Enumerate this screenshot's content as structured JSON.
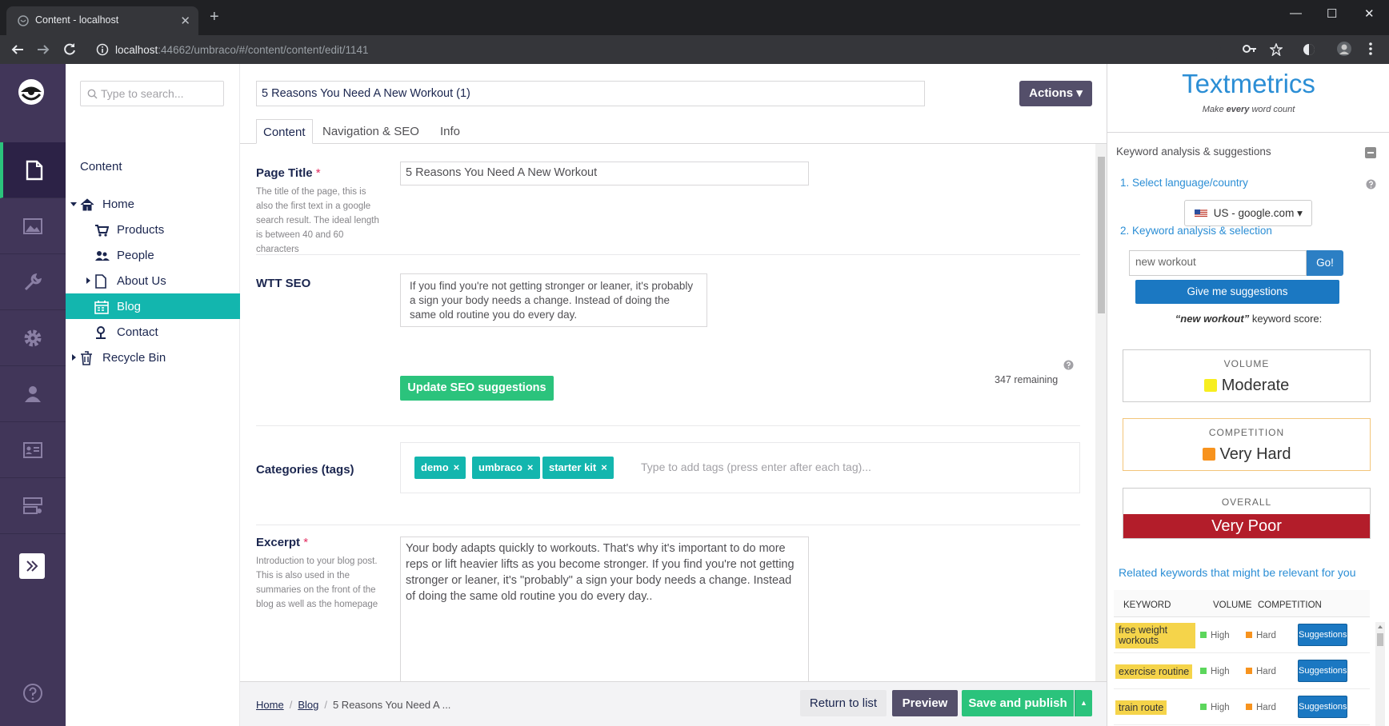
{
  "browser": {
    "tab_title": "Content - localhost",
    "url_host": "localhost",
    "url_rest": ":44662/umbraco/#/content/content/edit/1141"
  },
  "sidebar_nav": {
    "items": [
      "content-icon",
      "media-icon",
      "settings-icon",
      "gear-icon",
      "user-icon",
      "members-icon",
      "forms-icon"
    ],
    "accent": "#2bc37c",
    "bg": "#413659"
  },
  "tree": {
    "search_placeholder": "Type to search...",
    "heading": "Content",
    "nodes": [
      {
        "label": "Home",
        "icon": "home-icon"
      },
      {
        "label": "Products",
        "icon": "cart-icon"
      },
      {
        "label": "People",
        "icon": "people-icon"
      },
      {
        "label": "About Us",
        "icon": "document-icon"
      },
      {
        "label": "Blog",
        "icon": "calendar-icon"
      },
      {
        "label": "Contact",
        "icon": "map-pin-icon"
      },
      {
        "label": "Recycle Bin",
        "icon": "trash-icon"
      }
    ]
  },
  "editor": {
    "node_name": "5 Reasons You Need A New Workout (1)",
    "actions_label": "Actions",
    "tabs": [
      "Content",
      "Navigation & SEO",
      "Info"
    ],
    "page_title": {
      "label": "Page Title",
      "required": "*",
      "description": "The title of the page, this is also the first text in a google search result. The ideal length is between 40 and 60 characters",
      "value": "5 Reasons You Need A New Workout"
    },
    "wtt_seo": {
      "label": "WTT SEO",
      "value": "If you find you're not getting stronger or leaner, it's probably a sign your body needs a change. Instead of doing the same old routine you do every day.",
      "remaining": "347 remaining",
      "button": "Update SEO suggestions"
    },
    "categories": {
      "label": "Categories (tags)",
      "tags": [
        "demo",
        "umbraco",
        "starter kit"
      ],
      "placeholder": "Type to add tags (press enter after each tag)..."
    },
    "excerpt": {
      "label": "Excerpt",
      "required": "*",
      "description": "Introduction to your blog post. This is also used in the summaries on the front of the blog as well as the homepage",
      "value": "Your body adapts quickly to workouts. That's why it's important to do more reps or lift heavier lifts as you become stronger. If you find you're not getting stronger or leaner, it's \"probably\" a sign your body needs a change. Instead of doing the same old routine you do every day.."
    }
  },
  "footer": {
    "crumbs": [
      "Home",
      "Blog",
      "5 Reasons You Need A ..."
    ],
    "return_label": "Return to list",
    "preview_label": "Preview",
    "save_label": "Save and publish"
  },
  "textmetrics": {
    "logo": "Textmetrics",
    "tagline_pre": "Make ",
    "tagline_em": "every",
    "tagline_post": " word count",
    "panel_title": "Keyword analysis & suggestions",
    "step1": "1. Select language/country",
    "country": "US - google.com",
    "step2": "2. Keyword analysis & selection",
    "keyword_value": "new workout",
    "go_label": "Go!",
    "suggest_label": "Give me suggestions",
    "score_keyword": "“new workout”",
    "score_suffix": " keyword score:",
    "volume": {
      "caption": "VOLUME",
      "value": "Moderate",
      "color": "#f7ee1f"
    },
    "competition": {
      "caption": "COMPETITION",
      "value": "Very Hard",
      "color": "#f7931e"
    },
    "overall": {
      "caption": "OVERALL",
      "value": "Very Poor",
      "color": "#b31d2a"
    },
    "related_title": "Related keywords that might be relevant for you",
    "related_headers": [
      "KEYWORD",
      "VOLUME",
      "COMPETITION"
    ],
    "related": [
      {
        "keyword": "free weight workouts",
        "volume": "High",
        "competition": "Hard",
        "button": "Suggestions"
      },
      {
        "keyword": "exercise routine",
        "volume": "High",
        "competition": "Hard",
        "button": "Suggestions"
      },
      {
        "keyword": "train route",
        "volume": "High",
        "competition": "Hard",
        "button": "Suggestions"
      }
    ],
    "volume_high_color": "#5cd65c",
    "competition_hard_color": "#f7931e"
  }
}
